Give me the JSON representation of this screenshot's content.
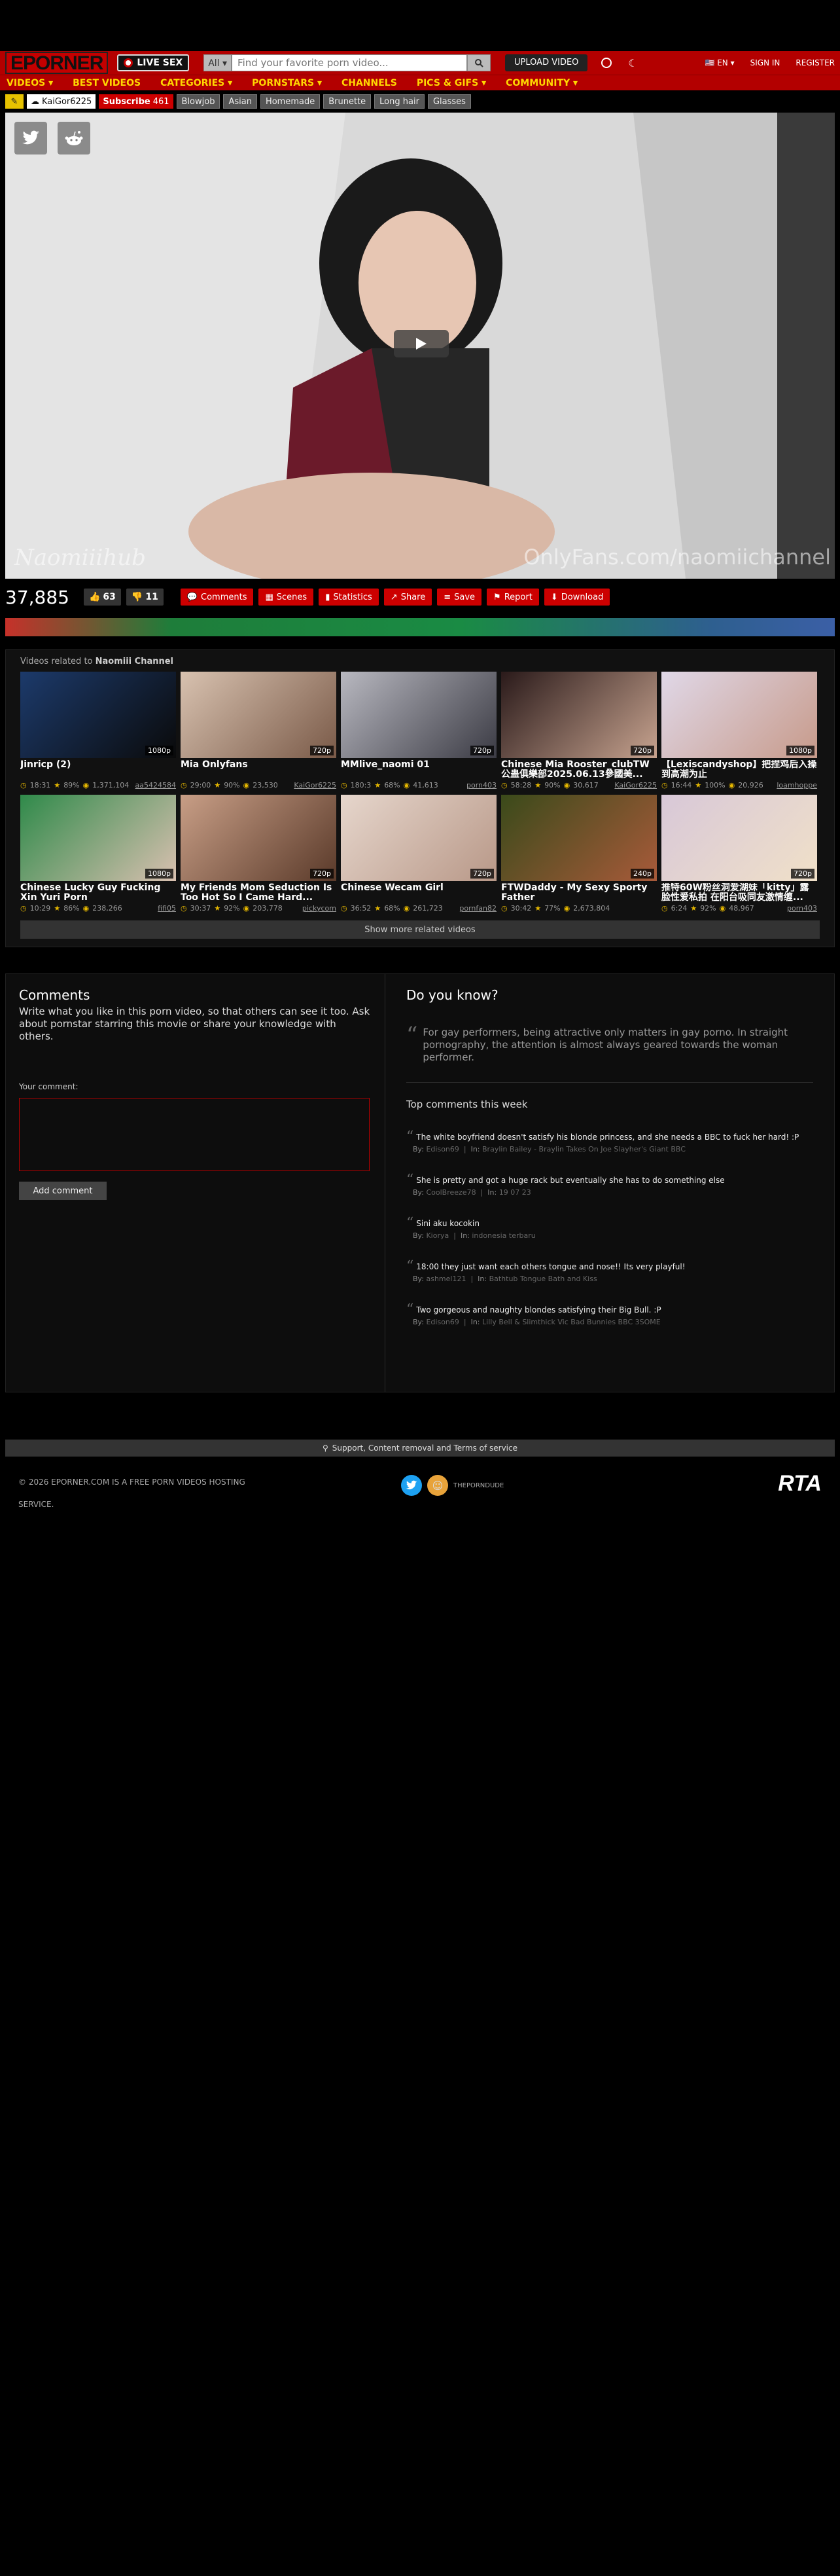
{
  "header": {
    "logo": "EPORNER",
    "live_sex": "LIVE SEX",
    "search_scope": "All ▾",
    "search_placeholder": "Find your favorite porn video...",
    "upload": "UPLOAD VIDEO",
    "lang": "EN ▾",
    "sign_in": "SIGN IN",
    "register": "REGISTER"
  },
  "nav": [
    "VIDEOS ▾",
    "BEST VIDEOS",
    "CATEGORIES ▾",
    "PORNSTARS ▾",
    "CHANNELS",
    "PICS & GIFS ▾",
    "COMMUNITY ▾"
  ],
  "tagbar": {
    "uploader": "KaiGor6225",
    "subscribe": "Subscribe",
    "subscribers": "461",
    "tags": [
      "Blowjob",
      "Asian",
      "Homemade",
      "Brunette",
      "Long hair",
      "Glasses"
    ]
  },
  "player": {
    "watermark_left": "Naomiiihub",
    "watermark_right": "OnlyFans.com/naomiichannel"
  },
  "stats": {
    "views": "37,885",
    "likes": "63",
    "dislikes": "11",
    "actions": [
      "Comments",
      "Scenes",
      "Statistics",
      "Share",
      "Save",
      "Report",
      "Download"
    ]
  },
  "related": {
    "label": "Videos related to",
    "channel": "Naomiii Channel",
    "show_more": "Show more related videos",
    "videos": [
      {
        "title": "Jinricp (2)",
        "quality": "1080p",
        "duration": "18:31",
        "rating": "89%",
        "views": "1,371,104",
        "user": "aa5424584"
      },
      {
        "title": "Mia Onlyfans",
        "quality": "720p",
        "duration": "29:00",
        "rating": "90%",
        "views": "23,530",
        "user": "KaiGor6225"
      },
      {
        "title": "MMlive_naomi 01",
        "quality": "720p",
        "duration": "180:3",
        "rating": "68%",
        "views": "41,613",
        "user": "porn403"
      },
      {
        "title": "Chinese Mia Rooster_clubTW 公蛊俱樂部2025.06.13參國美...",
        "quality": "720p",
        "duration": "58:28",
        "rating": "90%",
        "views": "30,617",
        "user": "KaiGor6225"
      },
      {
        "title": "【Lexiscandyshop】把捏鸡后入操到高潮为止",
        "quality": "1080p",
        "duration": "16:44",
        "rating": "100%",
        "views": "20,926",
        "user": "loamhoppe"
      },
      {
        "title": "Chinese Lucky Guy Fucking Xin Yuri Porn",
        "quality": "1080p",
        "duration": "10:29",
        "rating": "86%",
        "views": "238,266",
        "user": "fifi05"
      },
      {
        "title": "My Friends Mom Seduction Is Too Hot So I Came Hard...",
        "quality": "720p",
        "duration": "30:37",
        "rating": "92%",
        "views": "203,778",
        "user": "pickycom"
      },
      {
        "title": "Chinese Wecam Girl",
        "quality": "720p",
        "duration": "36:52",
        "rating": "68%",
        "views": "261,723",
        "user": "pornfan82"
      },
      {
        "title": "FTWDaddy - My Sexy Sporty Father",
        "quality": "240p",
        "duration": "30:42",
        "rating": "77%",
        "views": "2,673,804",
        "user": ""
      },
      {
        "title": "推特60W粉丝洞爱湖妹「kitty」露脸性爱私拍 在阳台吸同友激情缠...",
        "quality": "720p",
        "duration": "6:24",
        "rating": "92%",
        "views": "48,967",
        "user": "porn403"
      }
    ]
  },
  "comments": {
    "title": "Comments",
    "desc": "Write what you like in this porn video, so that others can see it too. Ask about pornstar starring this movie or share your knowledge with others.",
    "your_comment": "Your comment:",
    "add": "Add comment"
  },
  "dyk": {
    "title": "Do you know?",
    "text": "For gay performers, being attractive only matters in gay porno. In straight pornography, the attention is almost always geared towards the woman performer.",
    "top_title": "Top comments this week",
    "top": [
      {
        "text": "The white boyfriend doesn't satisfy his blonde princess, and she needs a BBC to fuck her hard! :P",
        "by": "Edison69",
        "in": "Braylin Bailey - Braylin Takes On Joe Slayher's Giant BBC"
      },
      {
        "text": "She is pretty and got a huge rack but eventually she has to do something else",
        "by": "CoolBreeze78",
        "in": "19 07 23"
      },
      {
        "text": "Sini aku kocokin",
        "by": "Kiorya",
        "in": "indonesia terbaru"
      },
      {
        "text": "18:00 they just want each others tongue and nose!! Its very playful!",
        "by": "ashmel121",
        "in": "Bathtub Tongue Bath and Kiss"
      },
      {
        "text": "Two gorgeous and naughty blondes satisfying their Big Bull. :P",
        "by": "Edison69",
        "in": "Lilly Bell & Slimthick Vic Bad Bunnies BBC 3SOME"
      }
    ],
    "by_label": "By:",
    "in_label": "In:"
  },
  "footer": {
    "bar": "Support, Content removal and Terms of service",
    "copyright": "© 2026 EPORNER.COM IS A FREE PORN VIDEOS HOSTING SERVICE.",
    "pg": "THEPORNDUDE",
    "rta": "RTA"
  },
  "colors": {
    "brand": "#b30000",
    "nav_text": "#ffd700",
    "accent_button": "#cc0000"
  }
}
